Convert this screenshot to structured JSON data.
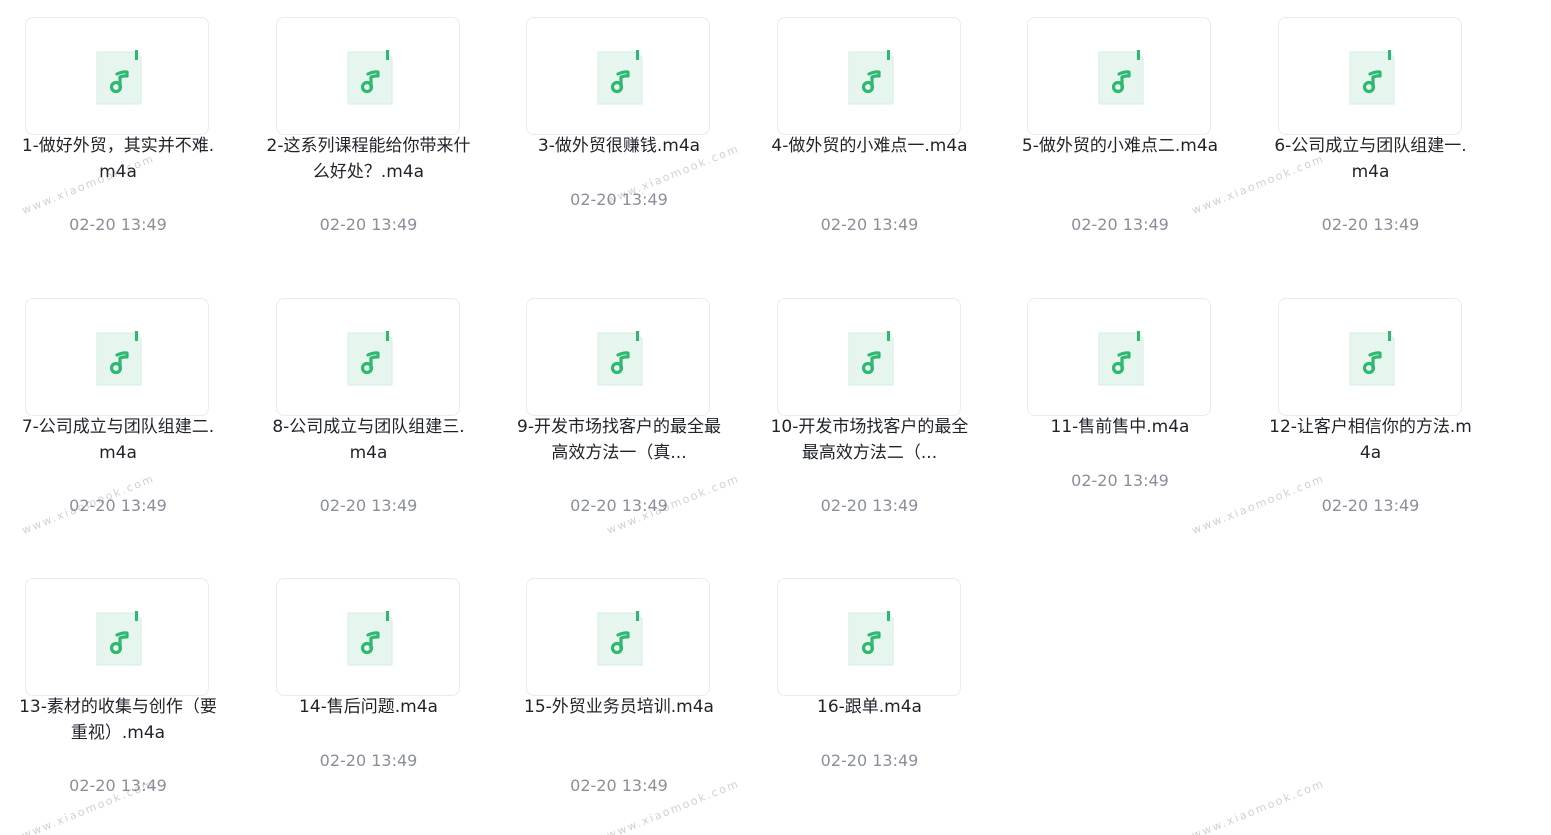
{
  "files": [
    {
      "name": "1-做好外贸，其实并不难.m4a",
      "time": "02-20 13:49",
      "lines": 2
    },
    {
      "name": "2-这系列课程能给你带来什么好处？.m4a",
      "time": "02-20 13:49",
      "lines": 2
    },
    {
      "name": "3-做外贸很赚钱.m4a",
      "time": "02-20 13:49",
      "lines": 1
    },
    {
      "name": "4-做外贸的小难点一.m4a",
      "time": "02-20 13:49",
      "lines": 2
    },
    {
      "name": "5-做外贸的小难点二.m4a",
      "time": "02-20 13:49",
      "lines": 2
    },
    {
      "name": "6-公司成立与团队组建一.m4a",
      "time": "02-20 13:49",
      "lines": 2
    },
    {
      "name": "7-公司成立与团队组建二.m4a",
      "time": "02-20 13:49",
      "lines": 2
    },
    {
      "name": "8-公司成立与团队组建三.m4a",
      "time": "02-20 13:49",
      "lines": 2
    },
    {
      "name": "9-开发市场找客户的最全最高效方法一（真...",
      "time": "02-20 13:49",
      "lines": 2
    },
    {
      "name": "10-开发市场找客户的最全最高效方法二（...",
      "time": "02-20 13:49",
      "lines": 2
    },
    {
      "name": "11-售前售中.m4a",
      "time": "02-20 13:49",
      "lines": 1
    },
    {
      "name": "12-让客户相信你的方法.m4a",
      "time": "02-20 13:49",
      "lines": 2
    },
    {
      "name": "13-素材的收集与创作（要重视）.m4a",
      "time": "02-20 13:49",
      "lines": 2
    },
    {
      "name": "14-售后问题.m4a",
      "time": "02-20 13:49",
      "lines": 1
    },
    {
      "name": "15-外贸业务员培训.m4a",
      "time": "02-20 13:49",
      "lines": 2
    },
    {
      "name": "16-跟单.m4a",
      "time": "02-20 13:49",
      "lines": 1
    }
  ],
  "icon": "audio-file-icon",
  "colors": {
    "icon_bg": "#e6f6ee",
    "icon_accent": "#2eb872",
    "name_text": "#1f2329",
    "time_text": "#8a8f99",
    "border": "#e9ebef"
  },
  "watermark": "www.xiaomook.com"
}
